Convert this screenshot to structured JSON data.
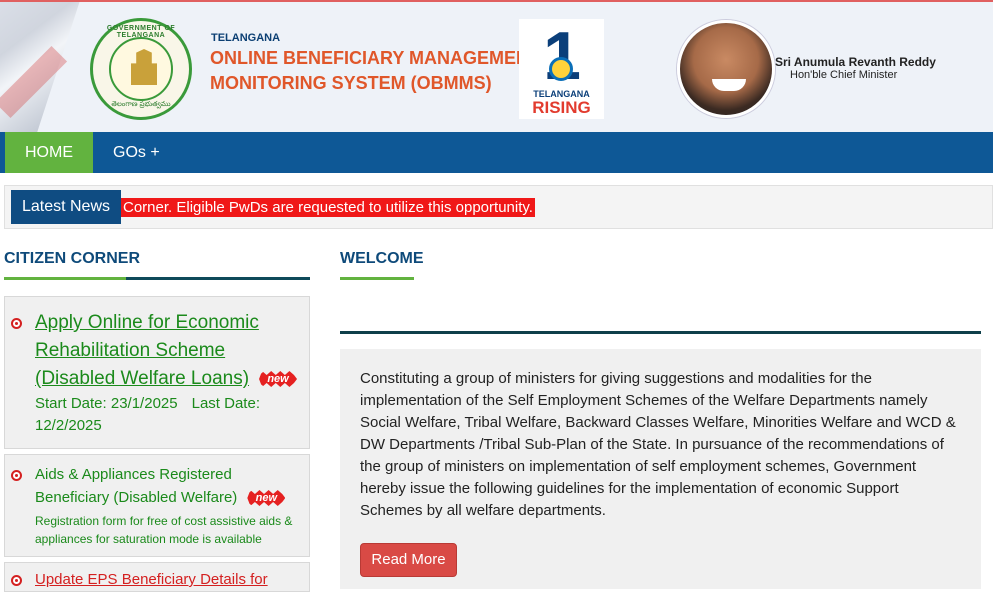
{
  "header": {
    "emblem_top_text": "GOVERNMENT OF TELANGANA",
    "emblem_bottom_text": "తెలంగాణ ప్రభుత్వము",
    "state": "TELANGANA",
    "title_line1": "ONLINE BENEFICIARY MANAGEMENT &",
    "title_line2": "MONITORING SYSTEM (OBMMS)",
    "rising_number": "1",
    "rising_line1": "TELANGANA",
    "rising_line2": "RISING",
    "cm_name": "Sri Anumula Revanth Reddy",
    "cm_role": "Hon'ble Chief Minister"
  },
  "nav": {
    "home": "HOME",
    "gos": "GOs +"
  },
  "news": {
    "label": "Latest News",
    "ticker": "Corner. Eligible PwDs are requested to utilize this opportunity."
  },
  "citizen_corner": {
    "title": "CITIZEN CORNER",
    "items": [
      {
        "link": "Apply Online for Economic Rehabilitation Scheme (Disabled Welfare Loans)",
        "badge": "new",
        "start": "Start Date: 23/1/2025",
        "end": "Last Date: 12/2/2025"
      },
      {
        "link": "Aids & Appliances Registered Beneficiary (Disabled Welfare)",
        "badge": "new",
        "desc": "Registration form for free of cost assistive aids & appliances for saturation mode is available"
      },
      {
        "link": "Update EPS Beneficiary Details for"
      }
    ]
  },
  "welcome": {
    "title": "WELCOME",
    "body": "Constituting a group of ministers for giving suggestions and modalities for the implementation of the Self Employment Schemes of the Welfare Departments namely Social Welfare, Tribal Welfare, Backward Classes Welfare, Minorities Welfare and WCD & DW Departments /Tribal Sub-Plan of the State. In pursuance of the recommendations of the group of ministers on implementation of self employment schemes, Government hereby issue the following guidelines for the implementation of economic Support Schemes by all welfare departments.",
    "read_more": "Read More"
  },
  "colors": {
    "nav_bg": "#0e5896",
    "home_active": "#62b33f",
    "title_orange": "#e0572a",
    "news_red": "#f01818",
    "link_green": "#1b8a1b",
    "button_red": "#d94a45"
  }
}
